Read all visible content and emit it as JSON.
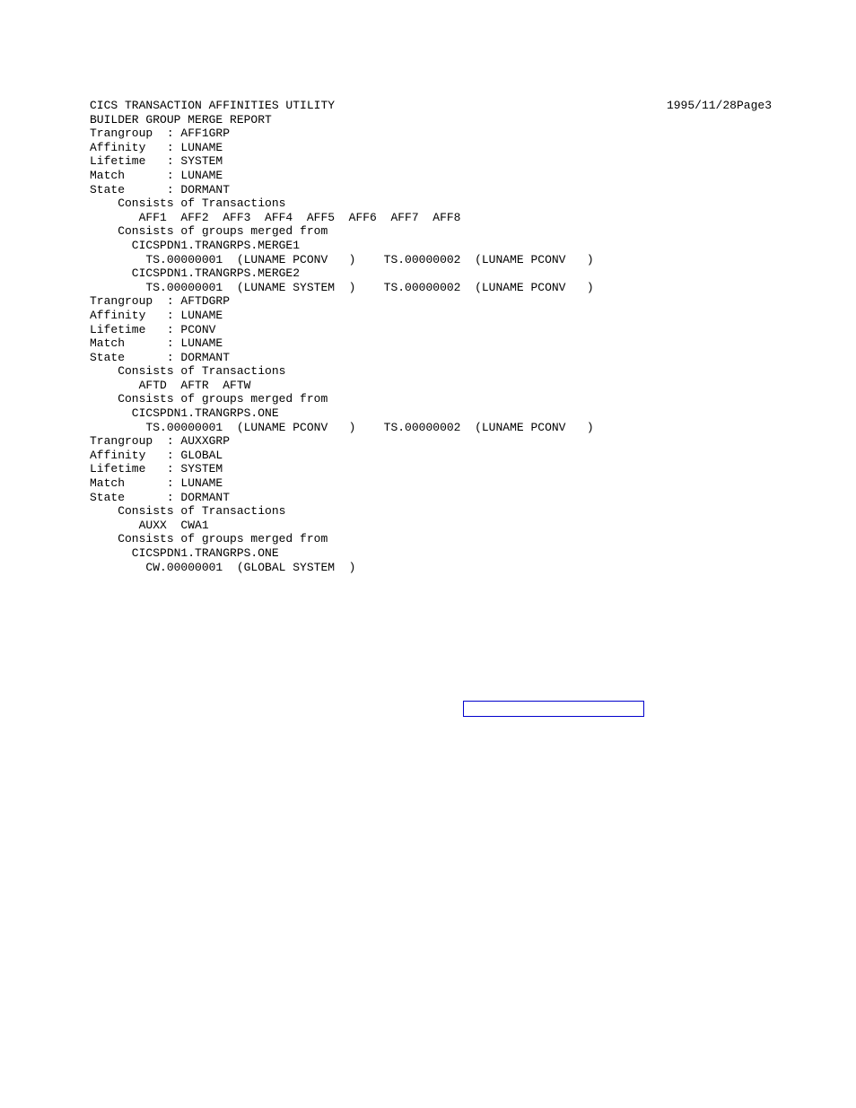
{
  "header": {
    "title": "CICS TRANSACTION AFFINITIES UTILITY",
    "date": "1995/11/28",
    "page_label": "Page",
    "page_no": "3",
    "subtitle": "BUILDER GROUP MERGE REPORT"
  },
  "groups": [
    {
      "trangroup": "AFF1GRP",
      "affinity": "LUNAME",
      "lifetime": "SYSTEM",
      "match": "LUNAME",
      "state": "DORMANT",
      "consists_of_transactions": "AFF1  AFF2  AFF3  AFF4  AFF5  AFF6  AFF7  AFF8",
      "merged_from": [
        {
          "dsn": "CICSPDN1.TRANGRPS.MERGE1",
          "entries": "TS.00000001  (LUNAME PCONV   )    TS.00000002  (LUNAME PCONV   )"
        },
        {
          "dsn": "CICSPDN1.TRANGRPS.MERGE2",
          "entries": "TS.00000001  (LUNAME SYSTEM  )    TS.00000002  (LUNAME PCONV   )"
        }
      ]
    },
    {
      "trangroup": "AFTDGRP",
      "affinity": "LUNAME",
      "lifetime": "PCONV",
      "match": "LUNAME",
      "state": "DORMANT",
      "consists_of_transactions": "AFTD  AFTR  AFTW",
      "merged_from": [
        {
          "dsn": "CICSPDN1.TRANGRPS.ONE",
          "entries": "TS.00000001  (LUNAME PCONV   )    TS.00000002  (LUNAME PCONV   )"
        }
      ]
    },
    {
      "trangroup": "AUXXGRP",
      "affinity": "GLOBAL",
      "lifetime": "SYSTEM",
      "match": "LUNAME",
      "state": "DORMANT",
      "consists_of_transactions": "AUXX  CWA1",
      "merged_from": [
        {
          "dsn": "CICSPDN1.TRANGRPS.ONE",
          "entries": "CW.00000001  (GLOBAL SYSTEM  )"
        }
      ]
    }
  ],
  "labels": {
    "trangroup": "Trangroup",
    "affinity": "Affinity",
    "lifetime": "Lifetime",
    "match": "Match",
    "state": "State",
    "consists_trans": "Consists of Transactions",
    "consists_merged": "Consists of groups merged from"
  }
}
